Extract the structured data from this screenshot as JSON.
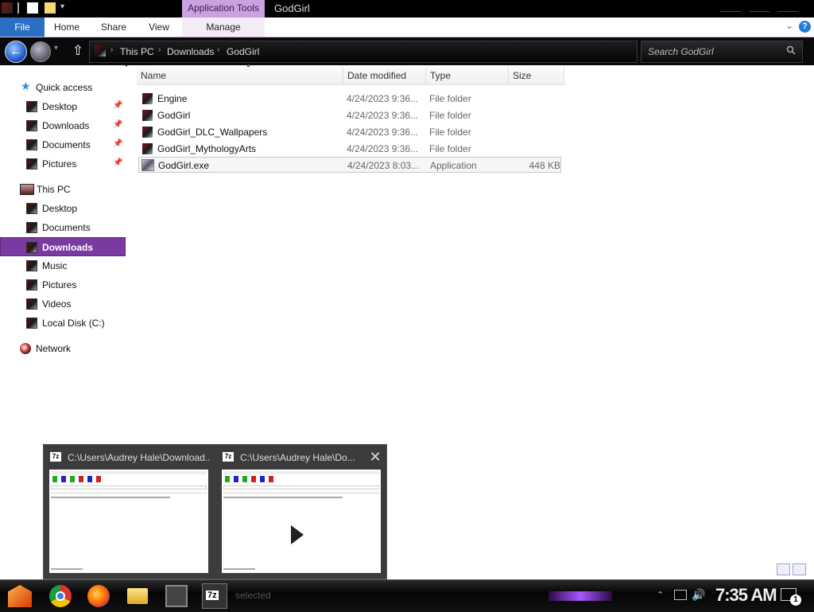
{
  "titlebar": {
    "app_tools_label": "Application Tools",
    "window_title": "GodGirl"
  },
  "ribbon": {
    "tabs": [
      "File",
      "Home",
      "Share",
      "View",
      "Manage"
    ],
    "help_label": "?"
  },
  "address": {
    "crumbs": [
      "This PC",
      "Downloads",
      "GodGirl"
    ],
    "search_placeholder": "Search GodGirl"
  },
  "nav": {
    "quick_access": "Quick access",
    "quick_items": [
      "Desktop",
      "Downloads",
      "Documents",
      "Pictures"
    ],
    "this_pc": "This PC",
    "pc_items": [
      "Desktop",
      "Documents",
      "Downloads",
      "Music",
      "Pictures",
      "Videos",
      "Local Disk (C:)"
    ],
    "network": "Network",
    "selected": "Downloads"
  },
  "columns": [
    "Name",
    "Date modified",
    "Type",
    "Size"
  ],
  "files": [
    {
      "name": "Engine",
      "date": "4/24/2023 9:36...",
      "type": "File folder",
      "size": ""
    },
    {
      "name": "GodGirl",
      "date": "4/24/2023 9:36...",
      "type": "File folder",
      "size": ""
    },
    {
      "name": "GodGirl_DLC_Wallpapers",
      "date": "4/24/2023 9:36...",
      "type": "File folder",
      "size": ""
    },
    {
      "name": "GodGirl_MythologyArts",
      "date": "4/24/2023 9:36...",
      "type": "File folder",
      "size": ""
    },
    {
      "name": "GodGirl.exe",
      "date": "4/24/2023 8:03...",
      "type": "Application",
      "size": "448 KB"
    }
  ],
  "thumbnails": [
    {
      "badge": "7z",
      "title": "C:\\Users\\Audrey Hale\\Download..."
    },
    {
      "badge": "7z",
      "title": "C:\\Users\\Audrey Hale\\Do..."
    }
  ],
  "taskbar": {
    "sevenz_label": "7z",
    "ghost_text": "selected",
    "clock": "7:35 AM",
    "notification_count": "1"
  }
}
